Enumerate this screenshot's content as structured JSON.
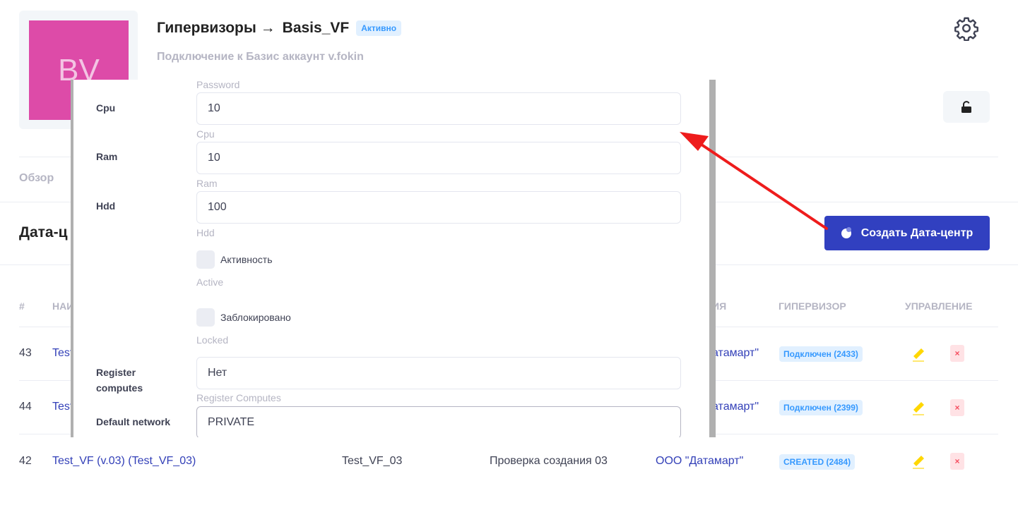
{
  "header": {
    "avatar_initials": "BV",
    "breadcrumb_root": "Гипервизоры →",
    "hypervisor_name": "Basis_VF",
    "status_badge": "Активно",
    "subtitle": "Подключение к Базис аккаунт v.fokin",
    "settings_icon": "gear-icon",
    "lock_icon": "unlock-icon"
  },
  "tabs": {
    "overview": "Обзор"
  },
  "section": {
    "title": "Дата-ц",
    "create_button": "Создать Дата-центр"
  },
  "table": {
    "headers": [
      "#",
      "НАИ",
      "ИЯ",
      "ГИПЕРВИЗОР",
      "УПРАВЛЕНИЕ"
    ],
    "rows": [
      {
        "id": "43",
        "name": "Test",
        "org": "атамарт\"",
        "status": "Подключен (2433)"
      },
      {
        "id": "44",
        "name": "Test",
        "org": "атамарт\"",
        "status": "Подключен (2399)"
      },
      {
        "id": "42",
        "name": "Test_VF (v.03) (Test_VF_03)",
        "code": "Test_VF_03",
        "desc": "Проверка создания 03",
        "org": "ООО \"Датамарт\"",
        "status": "CREATED (2484)"
      }
    ]
  },
  "modal": {
    "password_hint": "Password",
    "fields": [
      {
        "label": "Cpu",
        "value": "10",
        "hint": "Cpu"
      },
      {
        "label": "Ram",
        "value": "10",
        "hint": "Ram"
      },
      {
        "label": "Hdd",
        "value": "100",
        "hint": "Hdd"
      }
    ],
    "checkboxes": [
      {
        "label": "Активность",
        "hint": "Active"
      },
      {
        "label": "Заблокировано",
        "hint": "Locked"
      }
    ],
    "register_computes": {
      "label": "Register computes",
      "value": "Нет",
      "hint": "Register Computes"
    },
    "default_network": {
      "label": "Default network",
      "value": "PRIVATE"
    }
  },
  "colors": {
    "accent": "#3140c0",
    "arrow": "#ee1c1c",
    "avatar": "#dd4ba8"
  }
}
